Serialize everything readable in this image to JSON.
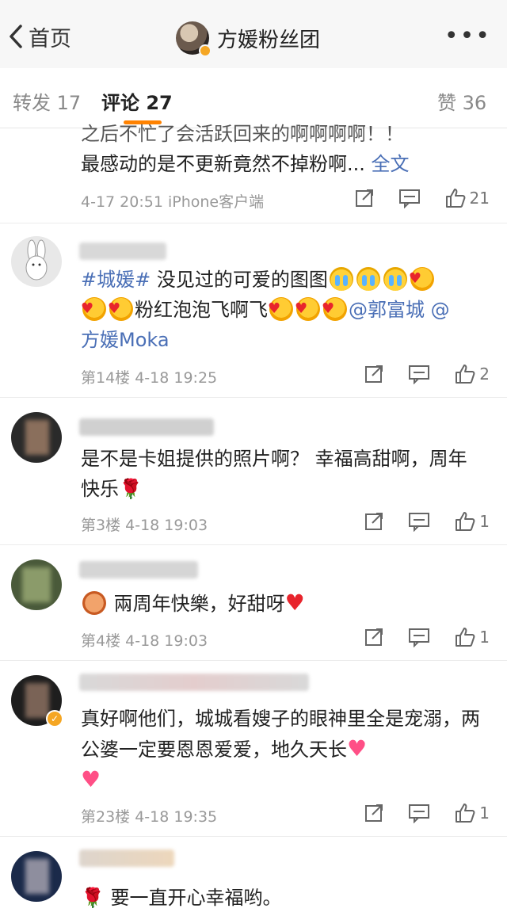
{
  "header": {
    "back_label": "首页",
    "title": "方媛粉丝团"
  },
  "tabs": [
    {
      "label": "转发 17"
    },
    {
      "label": "评论 27"
    },
    {
      "label": "赞 36"
    }
  ],
  "comments": [
    {
      "text_line1": "之后不忙了会活跃回来的啊啊啊啊！！",
      "text_line2": "最感动的是不更新竟然不掉粉啊... ",
      "full_text_link": "全文",
      "meta": "4-17 20:51 iPhone客户端",
      "likes": "21"
    },
    {
      "topic": "#城媛#",
      "text_a": " 没见过的可爱的图图",
      "text_b": "粉红泡泡飞啊飞",
      "mention1": "@郭富城",
      "mention2a": " @",
      "mention2b": "方媛Moka",
      "meta": "第14楼 4-18 19:25",
      "likes": "2"
    },
    {
      "text": "是不是卡姐提供的照片啊？ 幸福高甜啊，周年快乐",
      "meta": "第3楼 4-18 19:03",
      "likes": "1"
    },
    {
      "text": " 兩周年快樂，好甜呀",
      "meta": "第4楼 4-18 19:03",
      "likes": "1"
    },
    {
      "text": "真好啊他们，城城看嫂子的眼神里全是宠溺，两公婆一定要恩恩爱爱，地久天长",
      "meta": "第23楼 4-18 19:35",
      "likes": "1"
    },
    {
      "text": " 要一直开心幸福哟。"
    }
  ],
  "icons": {
    "back": "chevron-left-icon",
    "more": "more-dots-icon",
    "share": "share-icon",
    "comment": "comment-icon",
    "like": "thumbs-up-icon"
  },
  "colors": {
    "accent": "#ff8200",
    "link": "#4a6fb6"
  }
}
